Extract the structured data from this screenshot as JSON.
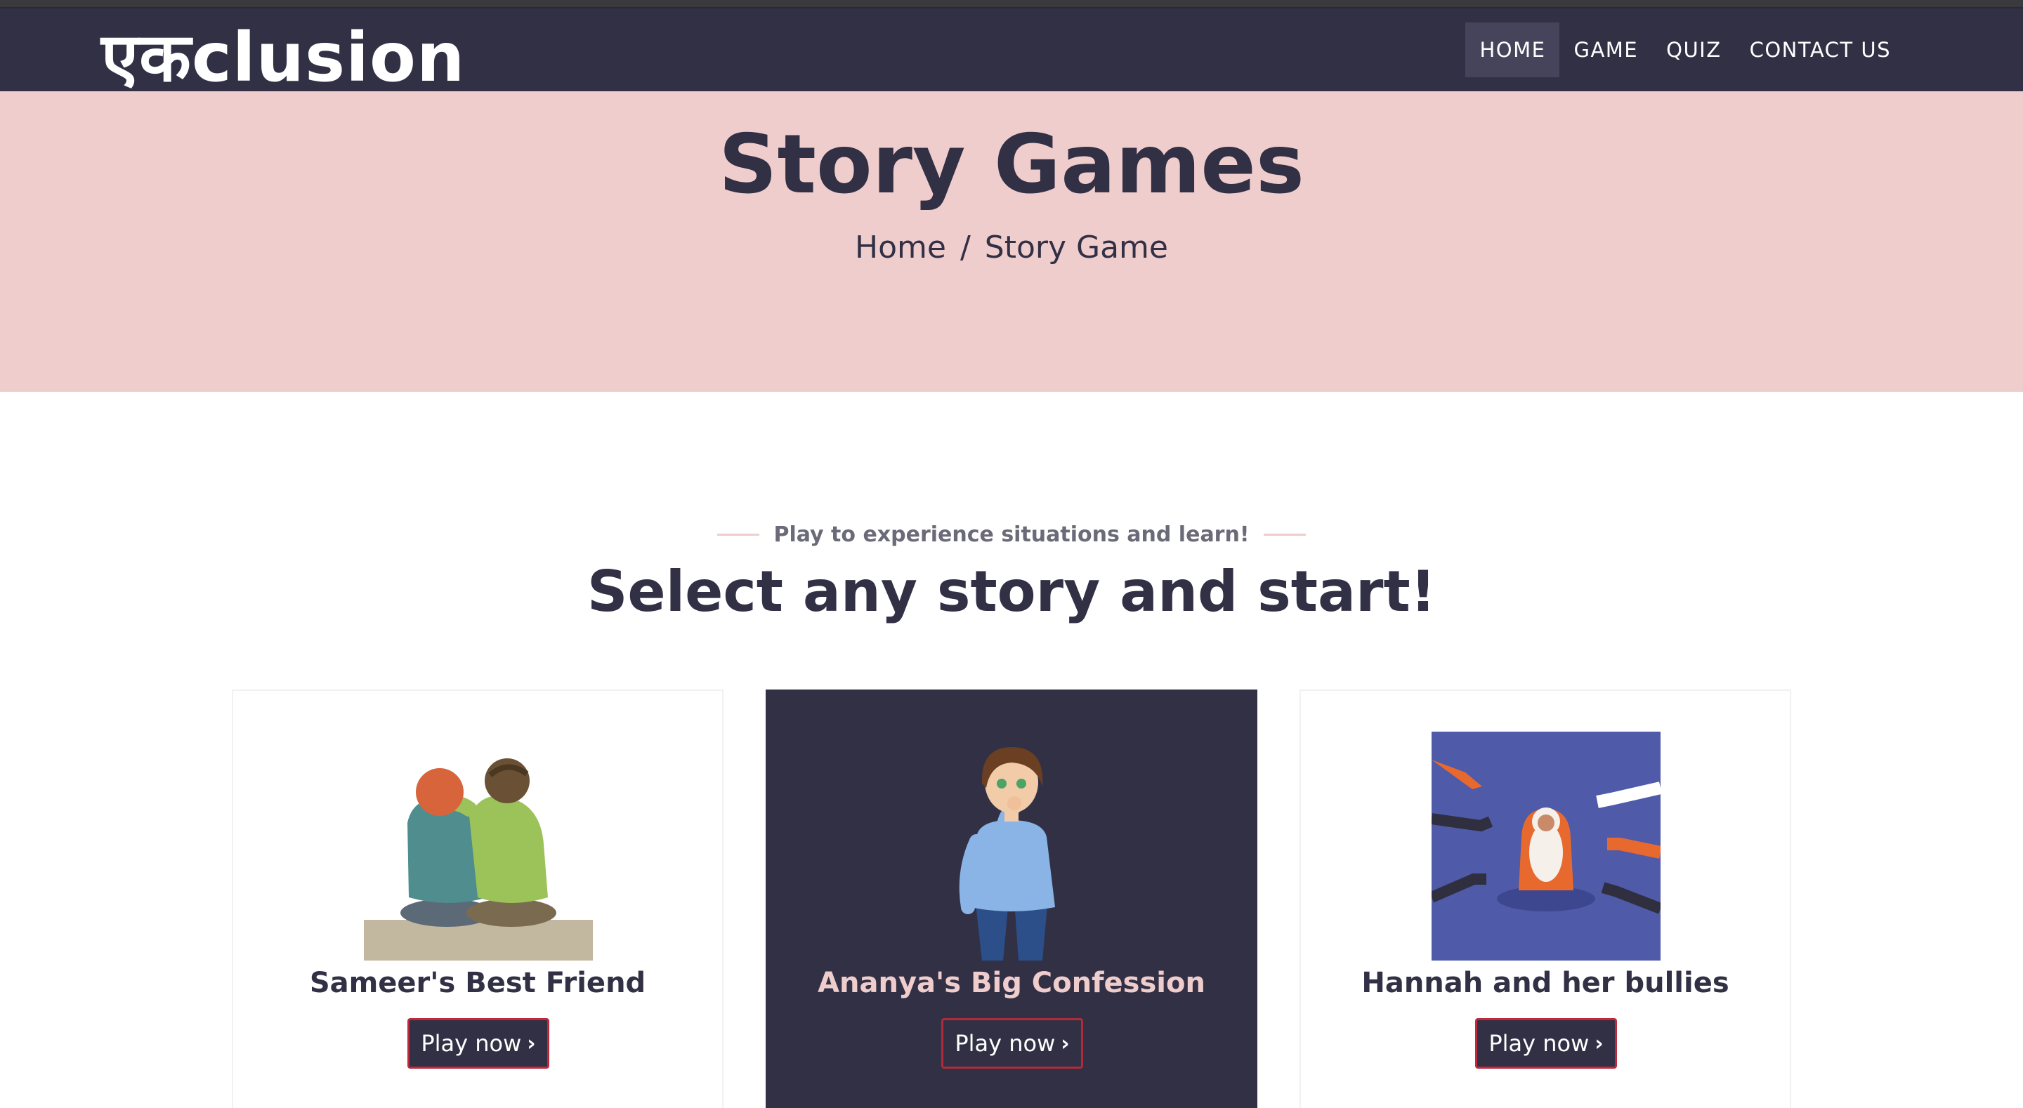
{
  "header": {
    "logo_text": "एकclusion",
    "nav": [
      {
        "label": "HOME",
        "active": true
      },
      {
        "label": "GAME",
        "active": false
      },
      {
        "label": "QUIZ",
        "active": false
      },
      {
        "label": "CONTACT US",
        "active": false
      }
    ]
  },
  "hero": {
    "title": "Story Games",
    "breadcrumb": {
      "home": "Home",
      "separator": "/",
      "current": "Story Game"
    }
  },
  "section": {
    "subtitle": "Play to experience situations and learn!",
    "title": "Select any story and start!"
  },
  "stories": [
    {
      "title": "Sameer's Best Friend",
      "button": "Play now",
      "chevron": "›",
      "image_icon": "two-friends-illustration"
    },
    {
      "title": "Ananya's Big Confession",
      "button": "Play now",
      "chevron": "›",
      "image_icon": "worried-girl-illustration"
    },
    {
      "title": "Hannah and her bullies",
      "button": "Play now",
      "chevron": "›",
      "image_icon": "bullying-illustration"
    }
  ],
  "colors": {
    "navy": "#323045",
    "pink": "#f0cdcd",
    "accent_red": "#c0283c",
    "bully_bg": "#4f5aa8"
  }
}
